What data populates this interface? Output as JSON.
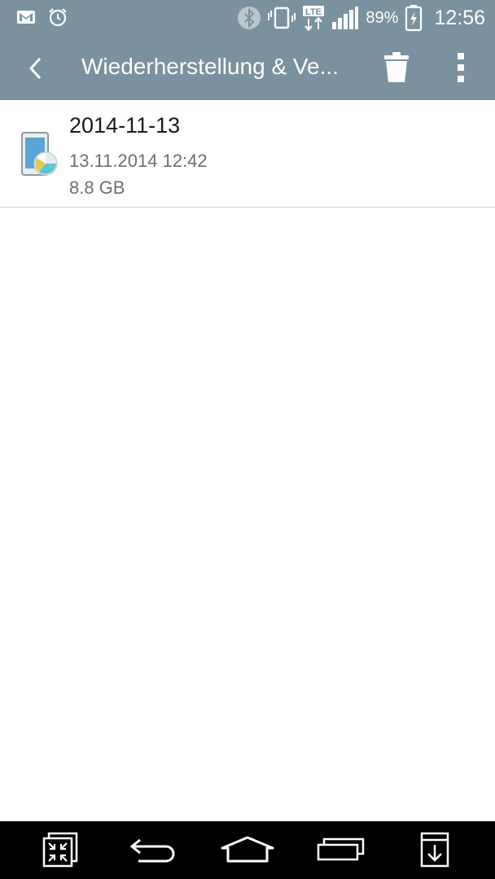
{
  "status_bar": {
    "left_icons": [
      "gmail-icon",
      "alarm-icon"
    ],
    "right_icons": [
      "bluetooth-icon",
      "vibrate-icon",
      "lte-icon",
      "signal-icon"
    ],
    "network_label": "LTE",
    "battery_percent": "89%",
    "battery_icon": "battery-charging-icon",
    "time": "12:56"
  },
  "app_bar": {
    "title": "Wiederherstellung & Ve...",
    "back_icon": "back-chevron-icon",
    "delete_icon": "trash-icon",
    "overflow_icon": "overflow-menu-icon",
    "color": "#7a919f"
  },
  "backups": [
    {
      "name": "2014-11-13",
      "date": "13.11.2014 12:42",
      "size": "8.8 GB",
      "icon": "phone-backup-icon"
    }
  ],
  "nav_bar": {
    "buttons": [
      "dual-window-icon",
      "back-icon",
      "home-icon",
      "recents-icon",
      "capture-plus-icon"
    ]
  }
}
